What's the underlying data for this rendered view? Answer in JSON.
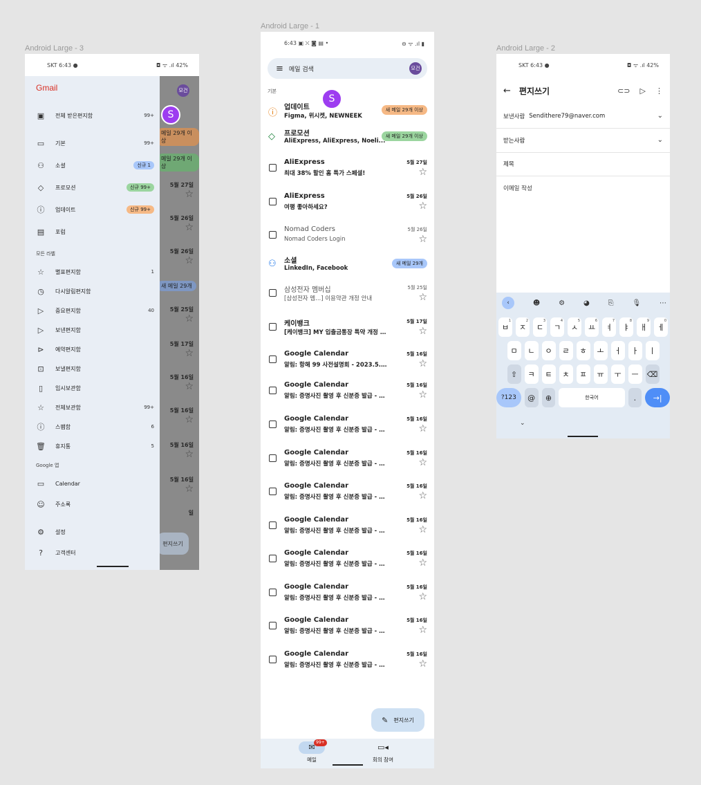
{
  "frames": {
    "drawer_label": "Android Large - 3",
    "inbox_label": "Android Large - 1",
    "compose_label": "Android Large - 2"
  },
  "drawer": {
    "status_left": "SKT 6:43 ●",
    "status_right": "◘ ᯤ .ıl 42%",
    "brand": "Gmail",
    "avatar_initials": "모건",
    "avatar_letter": "S",
    "items_top": [
      {
        "label": "전체 받은편지함",
        "count": "99+"
      },
      {
        "label": "기본",
        "count": "99+"
      },
      {
        "label": "소셜",
        "badge": "신규 1"
      },
      {
        "label": "프로모션",
        "badge": "신규 99+"
      },
      {
        "label": "업데이트",
        "badge": "신규 99+"
      },
      {
        "label": "포럼",
        "count": ""
      }
    ],
    "section_all": "모든 라벨",
    "items_labels": [
      {
        "label": "별표편지함",
        "count": "1"
      },
      {
        "label": "다시알림편지함",
        "count": ""
      },
      {
        "label": "중요편지함",
        "count": "40"
      },
      {
        "label": "보낸편지함",
        "count": ""
      },
      {
        "label": "예약편지함",
        "count": ""
      },
      {
        "label": "보낼편지함",
        "count": ""
      },
      {
        "label": "임시보관함",
        "count": ""
      },
      {
        "label": "전체보관함",
        "count": "99+"
      },
      {
        "label": "스팸함",
        "count": "6"
      },
      {
        "label": "휴지통",
        "count": "5"
      }
    ],
    "section_google": "Google 앱",
    "items_google": [
      {
        "label": "Calendar"
      },
      {
        "label": "주소록"
      }
    ],
    "items_bottom": [
      {
        "label": "설정"
      },
      {
        "label": "고객센터"
      }
    ],
    "bg_pills": [
      "메일 29개 이상",
      "메일 29개 이상",
      "새 메일 29개"
    ],
    "bg_dates": [
      "5월 27일",
      "5월 26일",
      "5월 26일",
      "5월 25일",
      "5월 17일",
      "5월 16일",
      "5월 16일",
      "5월 16일",
      "5월 16일",
      "일"
    ],
    "bg_fab": "편지쓰기"
  },
  "inbox": {
    "status_left": "6:43 ▣ ⛌ ◙ ▤ •",
    "status_right": "⊖ ᯤ .ıl ▮",
    "search_placeholder": "메일 검색",
    "avatar_initials": "모건",
    "avatar_letter": "S",
    "section": "기본",
    "rows": [
      {
        "type": "category",
        "icon": "ⓘ",
        "from": "업데이트",
        "subject": "Figma, 위시켓, NEWNEEK",
        "pill": "새 메일 29개 이상"
      },
      {
        "type": "category",
        "icon": "◇",
        "from": "프로모션",
        "subject": "AliExpress, AliExpress, Noeli...",
        "pill": "새 메일 29개 이상"
      },
      {
        "type": "mail",
        "from": "AliExpress",
        "subject": "최대 38% 할인 홈 특가 스페셜!",
        "date": "5월 27일"
      },
      {
        "type": "mail",
        "from": "AliExpress",
        "subject": "여행 좋아하세요?",
        "date": "5월 26일"
      },
      {
        "type": "mail",
        "read": true,
        "from": "Nomad Coders",
        "subject": "Nomad Coders Login",
        "date": "5월 26일"
      },
      {
        "type": "category",
        "icon": "⚇",
        "from": "소셜",
        "subject": "LinkedIn, Facebook",
        "pill": "새 메일 29개"
      },
      {
        "type": "mail",
        "read": true,
        "from": "삼성전자 멤버십",
        "subject": "[삼성전자 멤...] 이용약관 개정 안내",
        "date": "5월 25일"
      },
      {
        "type": "mail",
        "from": "케이뱅크",
        "subject": "[케이뱅크] MY 입출금통장 특약 개정 안내",
        "date": "5월 17일"
      },
      {
        "type": "mail",
        "from": "Google Calendar",
        "subject": "알림: 항해 99 사전설명회 - 2023.5.16 (...",
        "date": "5월 16일"
      },
      {
        "type": "mail",
        "from": "Google Calendar",
        "subject": "알림: 증명사진 촬영 후 신분증 발급 - 202...",
        "date": "5월 16일"
      },
      {
        "type": "mail",
        "from": "Google Calendar",
        "subject": "알림: 증명사진 촬영 후 신분증 발급 - 202...",
        "date": "5월 16일"
      },
      {
        "type": "mail",
        "from": "Google Calendar",
        "subject": "알림: 증명사진 촬영 후 신분증 발급 - 202...",
        "date": "5월 16일"
      },
      {
        "type": "mail",
        "from": "Google Calendar",
        "subject": "알림: 증명사진 촬영 후 신분증 발급 - 202...",
        "date": "5월 16일"
      },
      {
        "type": "mail",
        "from": "Google Calendar",
        "subject": "알림: 증명사진 촬영 후 신분증 발급 - 202...",
        "date": "5월 16일"
      },
      {
        "type": "mail",
        "from": "Google Calendar",
        "subject": "알림: 증명사진 촬영 후 신분증 발급 - 202...",
        "date": "5월 16일"
      },
      {
        "type": "mail",
        "from": "Google Calendar",
        "subject": "알림: 증명사진 촬영 후 신분증 발급 - 202...",
        "date": "5월 16일"
      },
      {
        "type": "mail",
        "from": "Google Calendar",
        "subject": "알림: 증명사진 촬영 후 신분증 발급 - 202...",
        "date": "5월 16일"
      },
      {
        "type": "mail",
        "from": "Google Calendar",
        "subject": "알림: 증명사진 촬영 후 신분증 발급 - 202...",
        "date": "5월 16일"
      }
    ],
    "fab_label": "편지쓰기",
    "nav_mail": "메일",
    "nav_mail_badge": "99+",
    "nav_meet": "회의 참여"
  },
  "compose": {
    "status_left": "SKT 6:43 ●",
    "status_right": "◘ ᯤ .ıl 42%",
    "title": "편지쓰기",
    "from_label": "보낸사람",
    "from_value": "Sendithere79@naver.com",
    "to_label": "받는사람",
    "subject_placeholder": "제목",
    "body_placeholder": "이메일 작성",
    "keyboard": {
      "row1": [
        [
          "ㅂ",
          "1"
        ],
        [
          "ㅈ",
          "2"
        ],
        [
          "ㄷ",
          "3"
        ],
        [
          "ㄱ",
          "4"
        ],
        [
          "ㅅ",
          "5"
        ],
        [
          "ㅛ",
          "6"
        ],
        [
          "ㅕ",
          "7"
        ],
        [
          "ㅑ",
          "8"
        ],
        [
          "ㅐ",
          "9"
        ],
        [
          "ㅔ",
          "0"
        ]
      ],
      "row2": [
        "ㅁ",
        "ㄴ",
        "ㅇ",
        "ㄹ",
        "ㅎ",
        "ㅗ",
        "ㅓ",
        "ㅏ",
        "ㅣ"
      ],
      "row3": [
        "ㅋ",
        "ㅌ",
        "ㅊ",
        "ㅍ",
        "ㅠ",
        "ㅜ",
        "ㅡ"
      ],
      "num_key": "?123",
      "at_key": "@",
      "space_label": "한국어",
      "dot_key": "."
    }
  },
  "colors": {
    "update_pill": "#f6b985",
    "promo_pill": "#9bd59f",
    "social_pill": "#a8c7fa",
    "avatar": "#6a4c9c",
    "avatar_s": "#9d3df0"
  }
}
